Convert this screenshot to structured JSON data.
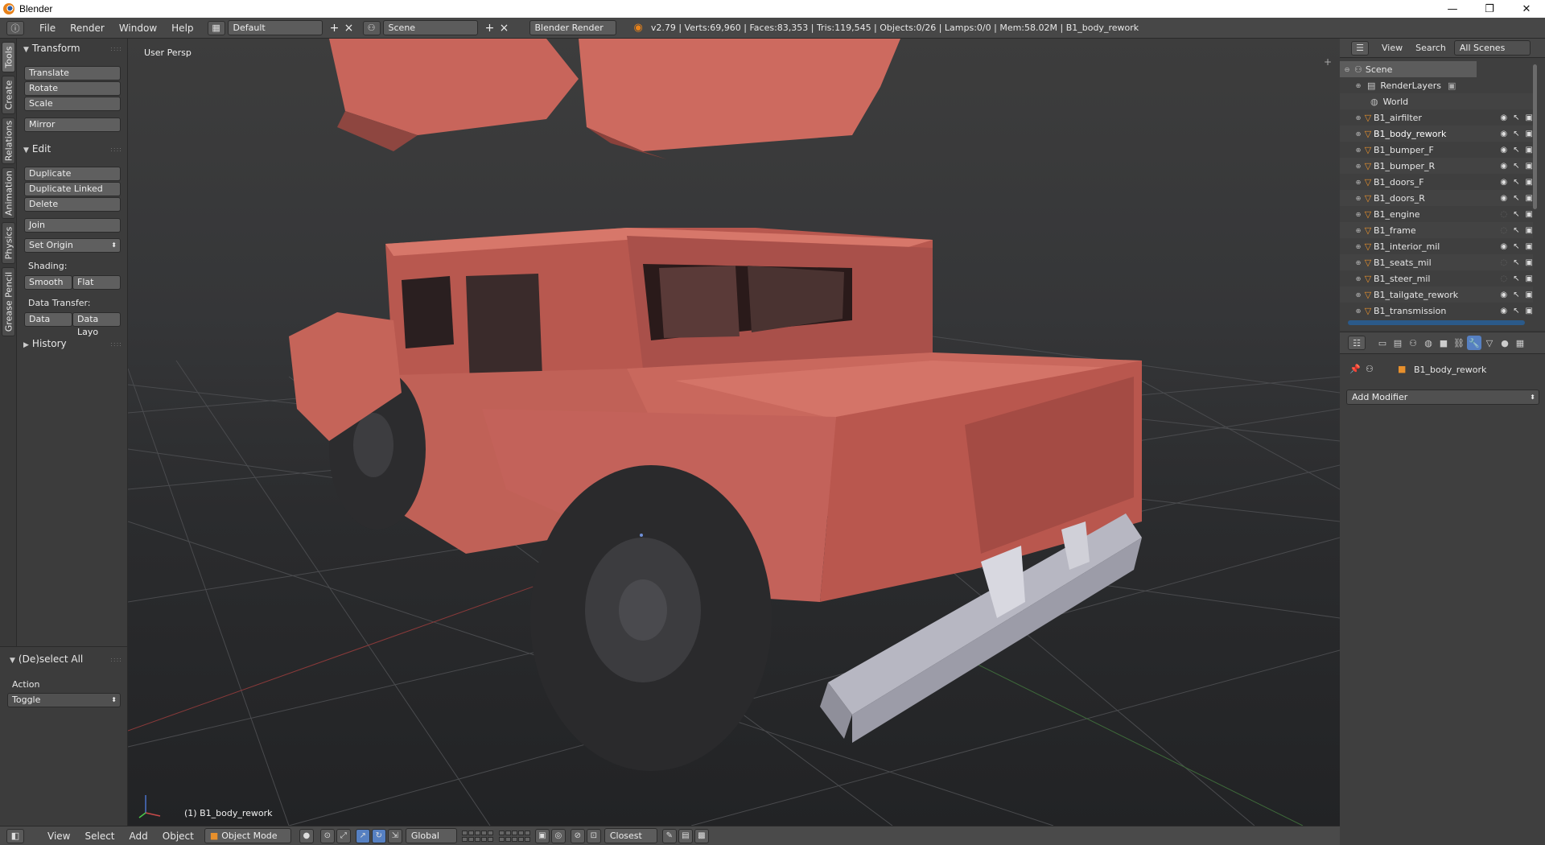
{
  "window": {
    "title": "Blender",
    "controls": [
      "—",
      "❐",
      "✕"
    ]
  },
  "info_header": {
    "menus": [
      "File",
      "Render",
      "Window",
      "Help"
    ],
    "layout": "Default",
    "scene": "Scene",
    "engine": "Blender Render",
    "stats": "v2.79 | Verts:69,960 | Faces:83,353 | Tris:119,545 | Objects:0/26 | Lamps:0/0 | Mem:58.02M | B1_body_rework"
  },
  "vertical_tabs": [
    "Tools",
    "Create",
    "Relations",
    "Animation",
    "Physics",
    "Grease Pencil"
  ],
  "tool_shelf": {
    "transform": {
      "header": "Transform",
      "buttons": [
        "Translate",
        "Rotate",
        "Scale",
        "Mirror"
      ]
    },
    "edit": {
      "header": "Edit",
      "buttons": [
        "Duplicate",
        "Duplicate Linked",
        "Delete",
        "Join"
      ],
      "set_origin": "Set Origin",
      "shading_label": "Shading:",
      "shading_buttons": [
        "Smooth",
        "Flat"
      ],
      "data_transfer_label": "Data Transfer:",
      "data_transfer_buttons": [
        "Data",
        "Data Layo"
      ]
    },
    "history": {
      "header": "History"
    }
  },
  "operator_panel": {
    "header": "(De)select All",
    "action_label": "Action",
    "action_value": "Toggle"
  },
  "viewport": {
    "view_label": "User Persp",
    "object_label": "(1) B1_body_rework",
    "model_color": "#c8645a",
    "bumper_color": "#a8a8b4",
    "tire_color": "#2a2a2c"
  },
  "view3d_header": {
    "menus": [
      "View",
      "Select",
      "Add",
      "Object"
    ],
    "mode": "Object Mode",
    "orientation": "Global",
    "snap": "Closest"
  },
  "outliner": {
    "menus": [
      "View",
      "Search",
      "All Scenes"
    ],
    "items": [
      {
        "name": "Scene",
        "kind": "scene"
      },
      {
        "name": "RenderLayers",
        "kind": "renderlayers"
      },
      {
        "name": "World",
        "kind": "world"
      },
      {
        "name": "B1_airfilter",
        "kind": "object"
      },
      {
        "name": "B1_body_rework",
        "kind": "object"
      },
      {
        "name": "B1_bumper_F",
        "kind": "object"
      },
      {
        "name": "B1_bumper_R",
        "kind": "object"
      },
      {
        "name": "B1_doors_F",
        "kind": "object"
      },
      {
        "name": "B1_doors_R",
        "kind": "object"
      },
      {
        "name": "B1_engine",
        "kind": "object"
      },
      {
        "name": "B1_frame",
        "kind": "object"
      },
      {
        "name": "B1_interior_mil",
        "kind": "object"
      },
      {
        "name": "B1_seats_mil",
        "kind": "object"
      },
      {
        "name": "B1_steer_mil",
        "kind": "object"
      },
      {
        "name": "B1_tailgate_rework",
        "kind": "object"
      },
      {
        "name": "B1_transmission",
        "kind": "object"
      }
    ]
  },
  "properties": {
    "object_name": "B1_body_rework",
    "add_modifier": "Add Modifier"
  }
}
